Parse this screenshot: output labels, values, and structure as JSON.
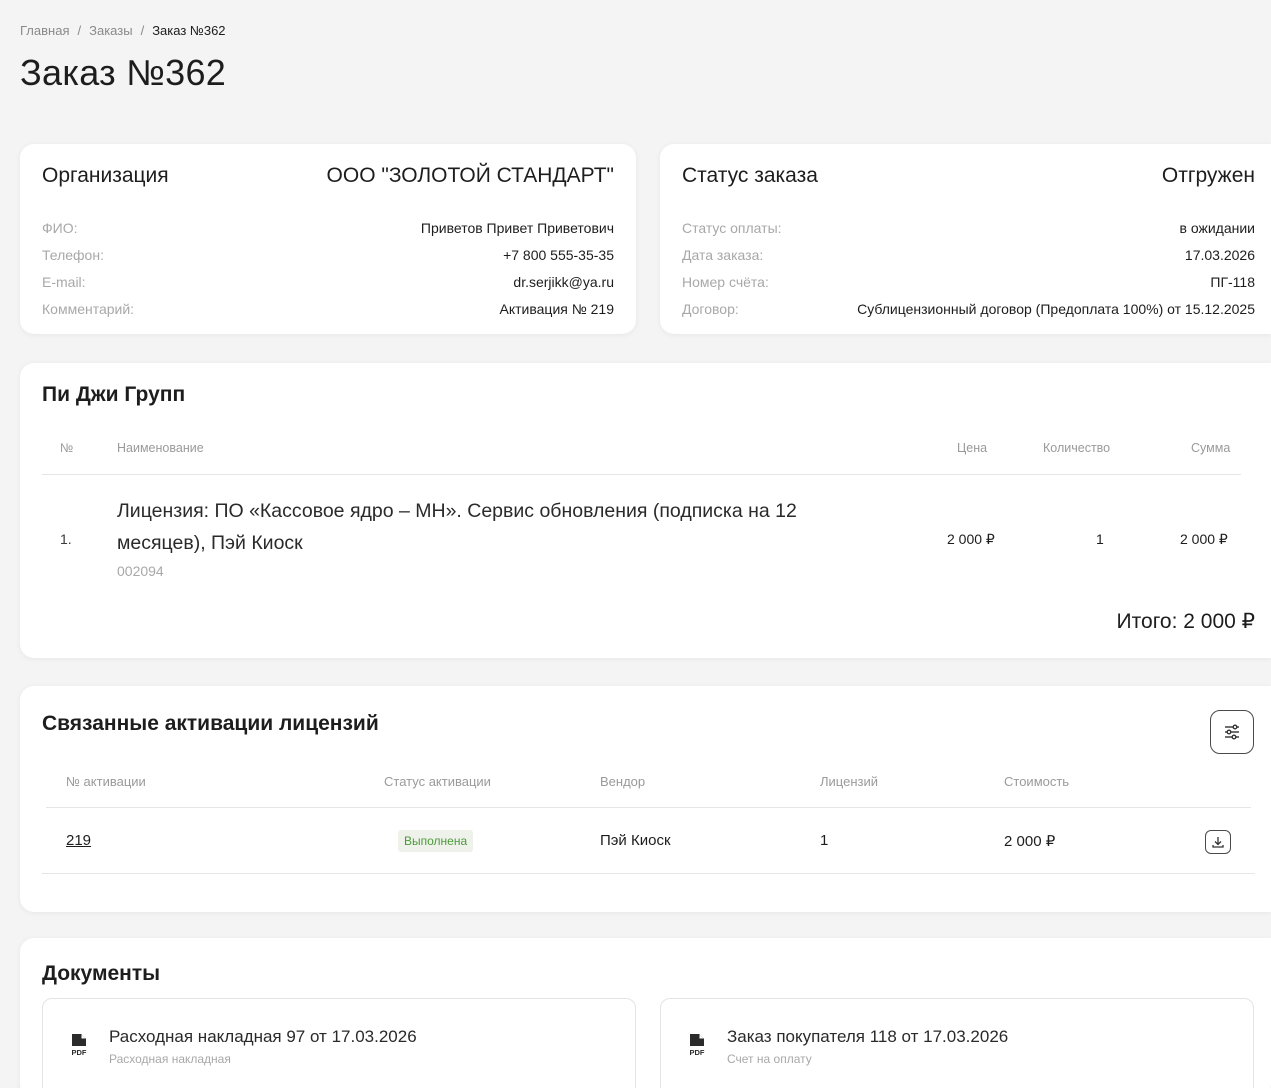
{
  "breadcrumb": {
    "home": "Главная",
    "orders": "Заказы",
    "current": "Заказ №362",
    "separator": "/"
  },
  "page_title": "Заказ №362",
  "organization": {
    "title": "Организация",
    "name": "ООО \"ЗОЛОТОЙ СТАНДАРТ\"",
    "fields": [
      {
        "label": "ФИО:",
        "value": "Приветов Привет Приветович"
      },
      {
        "label": "Телефон:",
        "value": "+7 800 555-35-35"
      },
      {
        "label": "E-mail:",
        "value": "dr.serjikk@ya.ru"
      },
      {
        "label": "Комментарий:",
        "value": "Активация № 219"
      }
    ]
  },
  "order_status": {
    "title": "Статус заказа",
    "value": "Отгружен",
    "fields": [
      {
        "label": "Статус оплаты:",
        "value": "в ожидании"
      },
      {
        "label": "Дата заказа:",
        "value": "17.03.2026"
      },
      {
        "label": "Номер счёта:",
        "value": "ПГ-118"
      },
      {
        "label": "Договор:",
        "value": "Сублицензионный договор (Предоплата 100%) от 15.12.2025"
      }
    ]
  },
  "items": {
    "vendor_title": "Пи Джи Групп",
    "columns": {
      "num": "№",
      "name": "Наименование",
      "price": "Цена",
      "qty": "Количество",
      "sum": "Сумма"
    },
    "rows": [
      {
        "num": "1.",
        "name": "Лицензия: ПО «Кассовое ядро – МН». Сервис обновления (подписка на 12 месяцев), Пэй Киоск",
        "code": "002094",
        "price": "2 000 ₽",
        "qty": "1",
        "sum": "2 000 ₽"
      }
    ],
    "total": "Итого: 2 000 ₽"
  },
  "activations": {
    "title": "Связанные активации лицензий",
    "filter_icon": "sliders-icon",
    "columns": {
      "num": "№ активации",
      "status": "Статус активации",
      "vendor": "Вендор",
      "licenses": "Лицензий",
      "cost": "Стоимость"
    },
    "rows": [
      {
        "num": "219",
        "status": "Выполнена",
        "vendor": "Пэй Киоск",
        "licenses": "1",
        "cost": "2 000 ₽",
        "action_icon": "download-icon"
      }
    ],
    "status_color": "#4c9a3a"
  },
  "documents": {
    "title": "Документы",
    "items": [
      {
        "title": "Расходная накладная 97 от 17.03.2026",
        "subtitle": "Расходная накладная",
        "icon": "pdf-icon"
      },
      {
        "title": "Заказ покупателя 118 от 17.03.2026",
        "subtitle": "Счет на оплату",
        "icon": "pdf-icon"
      }
    ]
  }
}
